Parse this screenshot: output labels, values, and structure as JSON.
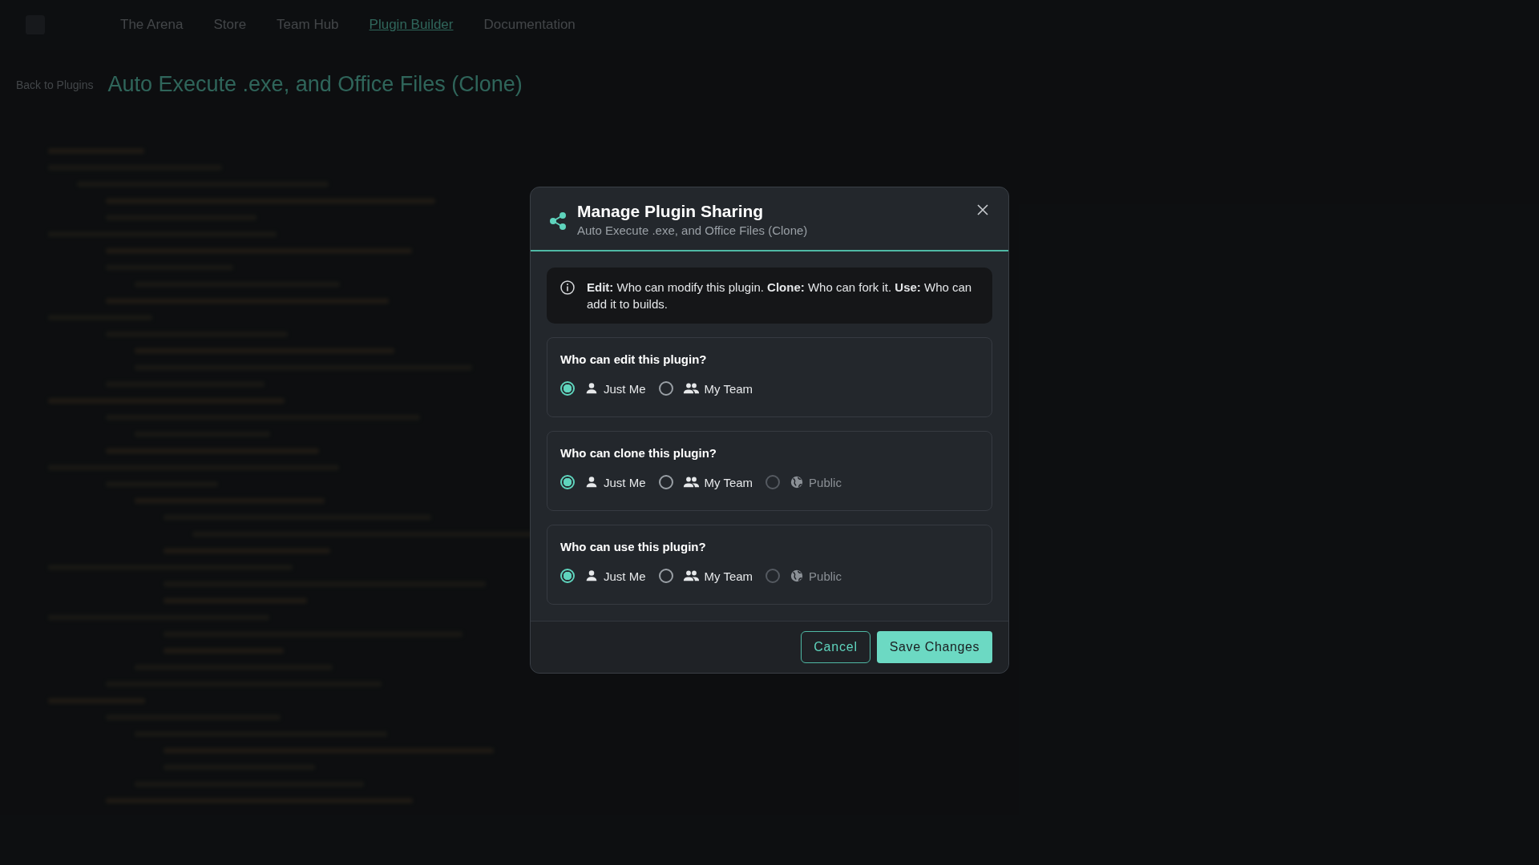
{
  "nav": {
    "items": [
      {
        "label": "The Arena",
        "selected": false
      },
      {
        "label": "Store",
        "selected": false
      },
      {
        "label": "Team Hub",
        "selected": false
      },
      {
        "label": "Plugin Builder",
        "selected": true
      },
      {
        "label": "Documentation",
        "selected": false
      }
    ]
  },
  "page": {
    "back_link": "Back to Plugins",
    "title": "Auto Execute .exe, and Office Files (Clone)"
  },
  "dialog": {
    "title": "Manage Plugin Sharing",
    "subtitle": "Auto Execute .exe, and Office Files (Clone)",
    "info": "**Edit:** Who can modify this plugin. **Clone:** Who can fork it. **Use:** Who can add it to builds.",
    "sections": [
      {
        "question": "Who can edit this plugin?",
        "options": [
          {
            "label": "Just Me",
            "kind": "person",
            "selected": true,
            "disabled": false
          },
          {
            "label": "My Team",
            "kind": "team",
            "selected": false,
            "disabled": false
          }
        ]
      },
      {
        "question": "Who can clone this plugin?",
        "options": [
          {
            "label": "Just Me",
            "kind": "person",
            "selected": true,
            "disabled": false
          },
          {
            "label": "My Team",
            "kind": "team",
            "selected": false,
            "disabled": false
          },
          {
            "label": "Public",
            "kind": "globe",
            "selected": false,
            "disabled": true
          }
        ]
      },
      {
        "question": "Who can use this plugin?",
        "options": [
          {
            "label": "Just Me",
            "kind": "person",
            "selected": true,
            "disabled": false
          },
          {
            "label": "My Team",
            "kind": "team",
            "selected": false,
            "disabled": false
          },
          {
            "label": "Public",
            "kind": "globe",
            "selected": false,
            "disabled": true
          }
        ]
      }
    ],
    "buttons": {
      "cancel": "Cancel",
      "save": "Save Changes"
    }
  }
}
